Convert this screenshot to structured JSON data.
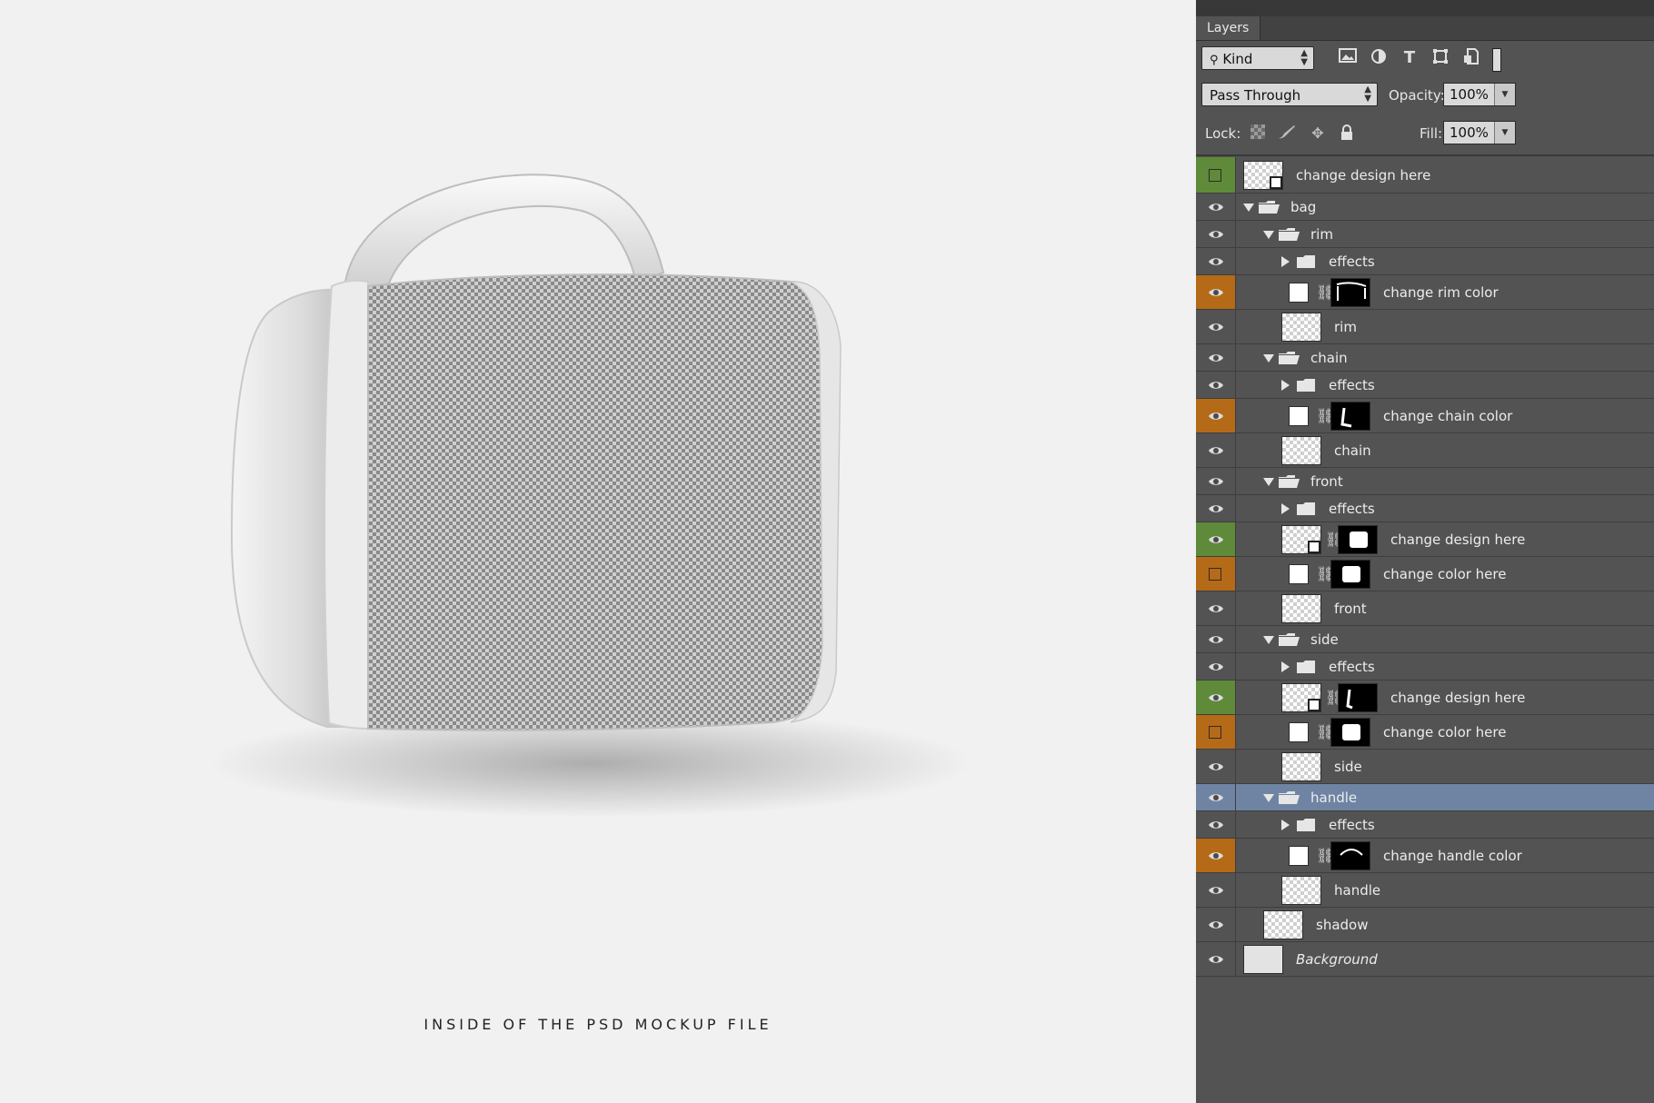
{
  "preview": {
    "caption": "INSIDE OF THE PSD MOCKUP FILE"
  },
  "panel": {
    "tab_label": "Layers",
    "filter": {
      "kind_label": "Kind",
      "icons": [
        "image-filter-icon",
        "adjustment-filter-icon",
        "type-filter-icon",
        "shape-filter-icon",
        "smart-object-filter-icon",
        "filter-toggle-icon"
      ]
    },
    "blend_mode": "Pass Through",
    "opacity_label": "Opacity:",
    "opacity_value": "100%",
    "lock_label": "Lock:",
    "lock_icons": [
      "lock-transparent-icon",
      "lock-paint-icon",
      "lock-position-icon",
      "lock-all-icon"
    ],
    "fill_label": "Fill:",
    "fill_value": "100%"
  },
  "layers": [
    {
      "name": "change design here",
      "type": "smart",
      "indent": 0,
      "visibility": "none",
      "color": "green"
    },
    {
      "name": "bag",
      "type": "group",
      "indent": 0,
      "open": true,
      "visibility": "eye"
    },
    {
      "name": "rim",
      "type": "group",
      "indent": 1,
      "open": true,
      "visibility": "eye"
    },
    {
      "name": "effects",
      "type": "group",
      "indent": 2,
      "open": false,
      "visibility": "eye"
    },
    {
      "name": "change rim color",
      "type": "fill",
      "indent": 2,
      "visibility": "eye",
      "color": "orange"
    },
    {
      "name": "rim",
      "type": "pixel",
      "indent": 2,
      "visibility": "eye"
    },
    {
      "name": "chain",
      "type": "group",
      "indent": 1,
      "open": true,
      "visibility": "eye"
    },
    {
      "name": "effects",
      "type": "group",
      "indent": 2,
      "open": false,
      "visibility": "eye"
    },
    {
      "name": "change chain color",
      "type": "fill",
      "indent": 2,
      "visibility": "eye",
      "color": "orange"
    },
    {
      "name": "chain",
      "type": "pixel",
      "indent": 2,
      "visibility": "eye"
    },
    {
      "name": "front",
      "type": "group",
      "indent": 1,
      "open": true,
      "visibility": "eye"
    },
    {
      "name": "effects",
      "type": "group",
      "indent": 2,
      "open": false,
      "visibility": "eye"
    },
    {
      "name": "change design here",
      "type": "smart-masked",
      "indent": 2,
      "visibility": "eye",
      "color": "green"
    },
    {
      "name": "change color here",
      "type": "fill",
      "indent": 2,
      "visibility": "none",
      "color": "orange"
    },
    {
      "name": "front",
      "type": "pixel",
      "indent": 2,
      "visibility": "eye"
    },
    {
      "name": "side",
      "type": "group",
      "indent": 1,
      "open": true,
      "visibility": "eye"
    },
    {
      "name": "effects",
      "type": "group",
      "indent": 2,
      "open": false,
      "visibility": "eye"
    },
    {
      "name": "change design here",
      "type": "smart-masked",
      "indent": 2,
      "visibility": "eye",
      "color": "green"
    },
    {
      "name": "change color here",
      "type": "fill",
      "indent": 2,
      "visibility": "none",
      "color": "orange"
    },
    {
      "name": "side",
      "type": "pixel",
      "indent": 2,
      "visibility": "eye"
    },
    {
      "name": "handle",
      "type": "group",
      "indent": 1,
      "open": true,
      "visibility": "eye",
      "selected": true
    },
    {
      "name": "effects",
      "type": "group",
      "indent": 2,
      "open": false,
      "visibility": "eye"
    },
    {
      "name": "change handle color",
      "type": "fill",
      "indent": 2,
      "visibility": "eye",
      "color": "orange"
    },
    {
      "name": "handle",
      "type": "pixel",
      "indent": 2,
      "visibility": "eye"
    },
    {
      "name": "shadow",
      "type": "pixel",
      "indent": 1,
      "visibility": "eye"
    },
    {
      "name": "Background",
      "type": "background",
      "indent": 0,
      "visibility": "eye",
      "italic": true
    }
  ],
  "colors": {
    "panel_bg": "#535353",
    "selected_row": "#6f84a3",
    "green_tag": "#5f8a3a",
    "orange_tag": "#b56a17"
  }
}
